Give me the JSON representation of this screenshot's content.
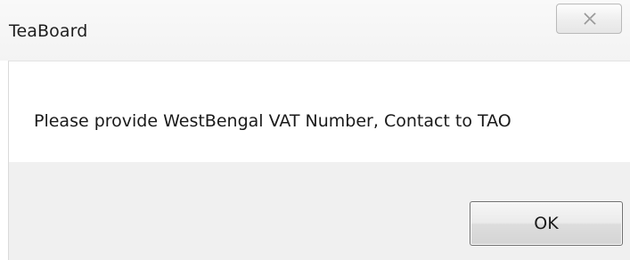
{
  "window": {
    "title": "TeaBoard"
  },
  "message": {
    "text": "Please provide WestBengal VAT Number, Contact to TAO"
  },
  "buttons": {
    "ok_label": "OK"
  },
  "icons": {
    "close": "close-icon"
  }
}
